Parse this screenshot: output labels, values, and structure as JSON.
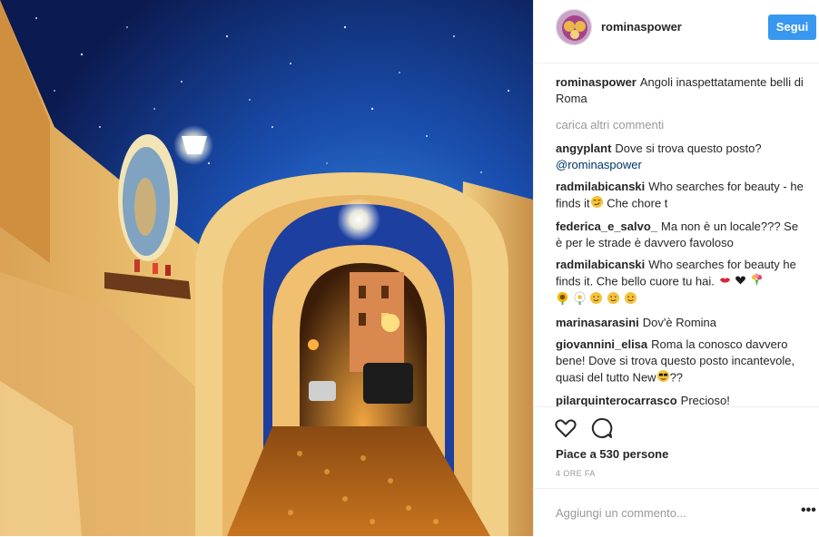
{
  "post": {
    "username": "rominaspower",
    "follow_label": "Segui",
    "caption_user": "rominaspower",
    "caption_text": "Angoli inaspettatamente belli di Roma",
    "load_more": "carica altri commenti",
    "comments": [
      {
        "user": "angyplant",
        "text": "Dove si trova questo posto?",
        "mention": "@rominaspower",
        "emojis": []
      },
      {
        "user": "radmilabicanski",
        "text": "Who searches for beauty - he finds it",
        "tail": " Che chore t",
        "emojis": [
          "smirk-face-emoji"
        ]
      },
      {
        "user": "federica_e_salvo_",
        "text": "Ma non è un locale??? Se è per le strade è davvero favoloso",
        "emojis": []
      },
      {
        "user": "radmilabicanski",
        "text": "Who searches for beauty he finds it. Che bello cuore tu hai.",
        "emojis": [
          "kiss-lips-emoji",
          "black-heart-emoji",
          "bouquet-emoji",
          "sunflower-emoji",
          "daisy-emoji",
          "smile-face-emoji",
          "smile-face-emoji",
          "smile-face-emoji"
        ]
      },
      {
        "user": "marinasarasini",
        "text": "Dov'è Romina",
        "emojis": []
      },
      {
        "user": "giovannini_elisa",
        "text": "Roma la conosco davvero bene! Dove si trova questo posto incantevole, quasi del tutto New",
        "tail": "??",
        "emojis": [
          "sunglasses-face-emoji"
        ]
      },
      {
        "user": "pilarquinterocarrasco",
        "text": "Precioso!",
        "emojis": []
      }
    ],
    "likes_text": "Piace a 530 persone",
    "time_text": "4 ORE FA",
    "comment_placeholder": "Aggiungi un commento...",
    "more_options": "•••"
  },
  "icons": {
    "like": "heart-outline-icon",
    "comment": "speech-bubble-icon"
  },
  "colors": {
    "follow_button": "#3897f0",
    "mention": "#003569",
    "muted": "#999999"
  }
}
